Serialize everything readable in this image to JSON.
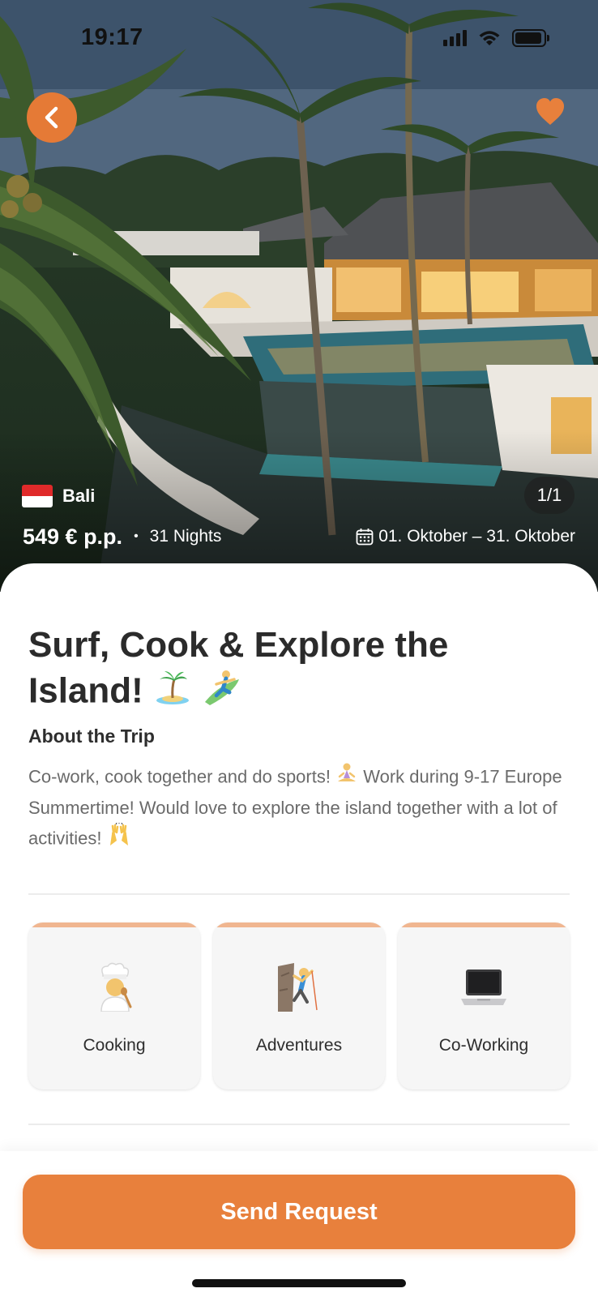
{
  "status": {
    "time": "19:17"
  },
  "header": {
    "back_icon": "chevron-left-icon",
    "favorite_icon": "heart-icon",
    "accent_color": "#e8803c"
  },
  "hero": {
    "location": "Bali",
    "flag": "indonesia-flag",
    "image_counter": "1/1",
    "price": "549 € p.p.",
    "separator": "•",
    "nights": "31 Nights",
    "calendar_icon": "calendar-icon",
    "dates": "01. Oktober – 31. Oktober"
  },
  "trip": {
    "title": "Surf, Cook & Explore the Island!",
    "title_emojis": [
      "island-emoji",
      "surfer-emoji"
    ],
    "about_heading": "About the Trip",
    "description_part1": "Co-work, cook together and do sports!",
    "description_part2": "Work during 9-17 Europe Summertime! Would love to explore the island together with a lot of activities!",
    "description_emojis": [
      "meditation-emoji",
      "raised-hands-emoji"
    ]
  },
  "activities": [
    {
      "label": "Cooking",
      "icon": "cook-emoji"
    },
    {
      "label": "Adventures",
      "icon": "climber-emoji"
    },
    {
      "label": "Co-Working",
      "icon": "laptop-emoji"
    }
  ],
  "actions": {
    "send_request": "Send Request"
  }
}
